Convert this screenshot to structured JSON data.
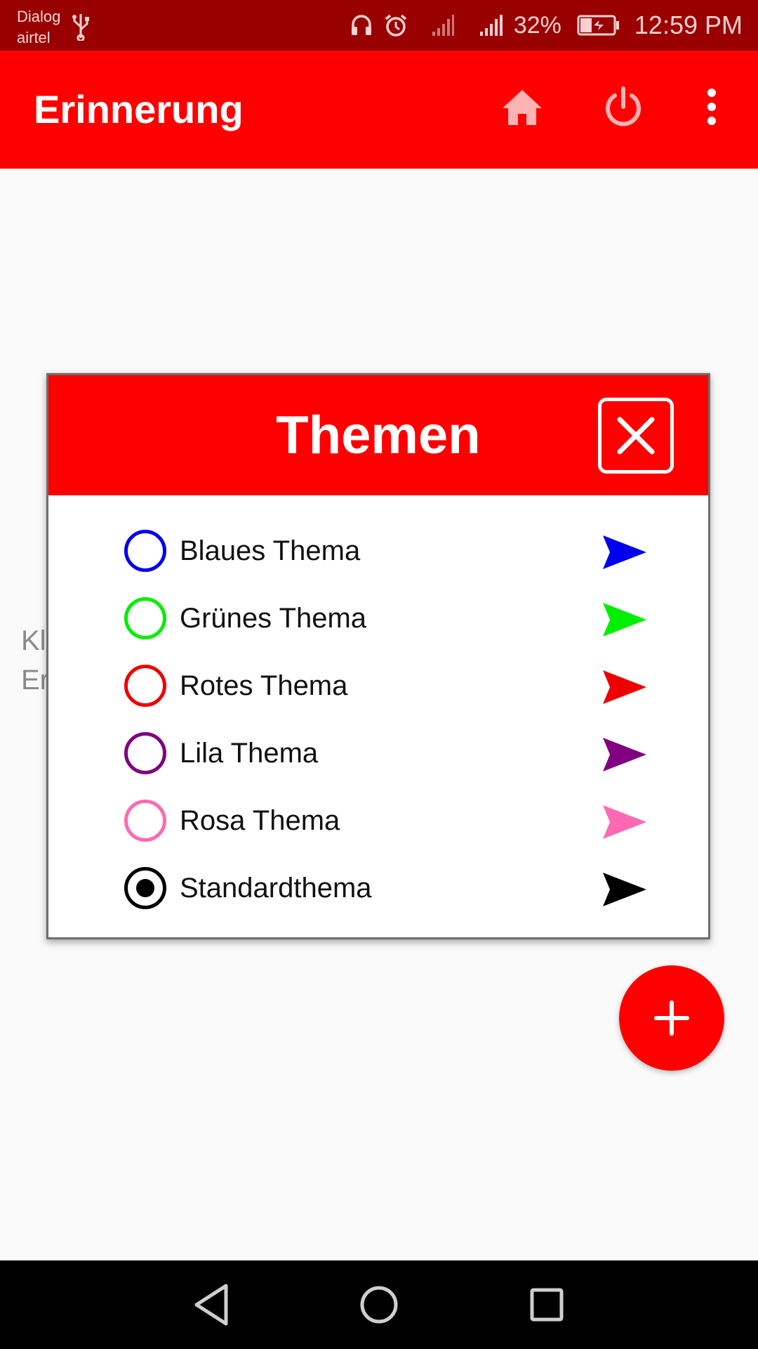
{
  "status_bar": {
    "carrier_line1": "Dialog",
    "carrier_line2": "airtel",
    "battery_percent": "32%",
    "time": "12:59 PM",
    "icons": [
      "usb-icon",
      "headset-icon",
      "alarm-icon",
      "signal-icon",
      "signal-icon",
      "battery-charging-icon"
    ]
  },
  "app_bar": {
    "title": "Erinnerung",
    "actions": [
      "home-icon",
      "power-icon",
      "more-vert-icon"
    ]
  },
  "background": {
    "hint_line1": "Kl",
    "hint_line2": "Er"
  },
  "dialog": {
    "title": "Themen",
    "close_icon": "close-icon",
    "themes": [
      {
        "label": "Blaues Thema",
        "color": "#0000ee",
        "selected": false
      },
      {
        "label": "Grünes Thema",
        "color": "#00ee00",
        "selected": false
      },
      {
        "label": "Rotes Thema",
        "color": "#ee0000",
        "selected": false
      },
      {
        "label": "Lila Thema",
        "color": "#800080",
        "selected": false
      },
      {
        "label": "Rosa Thema",
        "color": "#ff69b4",
        "selected": false
      },
      {
        "label": "Standardthema",
        "color": "#000000",
        "selected": true
      }
    ]
  },
  "fab": {
    "icon": "plus-icon"
  },
  "nav_bar": {
    "icons": [
      "back-icon",
      "home-circle-icon",
      "recents-icon"
    ]
  },
  "colors": {
    "status_bar": "#990000",
    "primary": "#ff0000",
    "background": "#fafafa"
  }
}
